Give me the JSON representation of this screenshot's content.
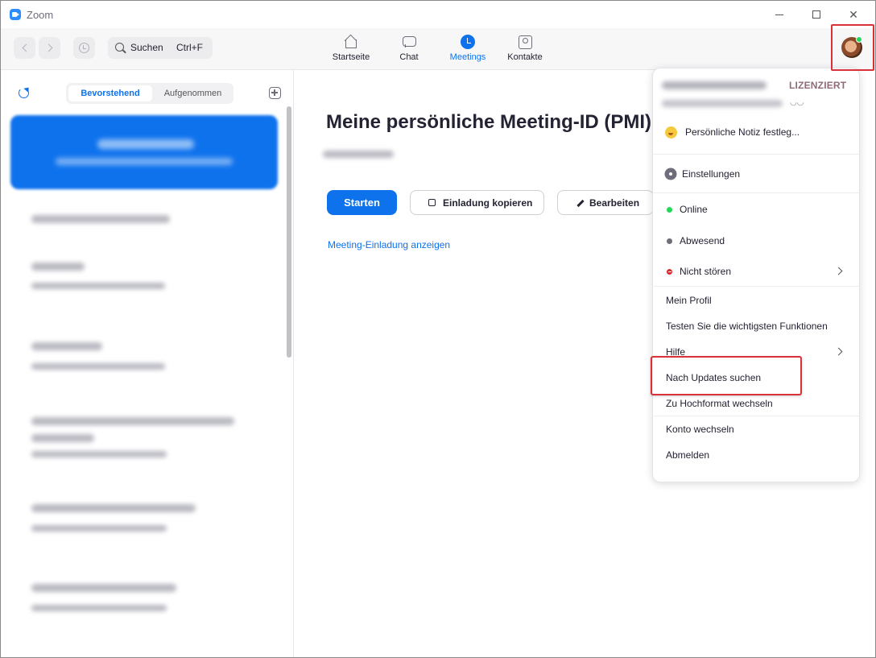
{
  "window": {
    "title": "Zoom",
    "close_glyph": "✕"
  },
  "toolbar": {
    "search_label": "Suchen",
    "search_shortcut": "Ctrl+F",
    "tabs": [
      {
        "label": "Startseite",
        "icon": "home-icon"
      },
      {
        "label": "Chat",
        "icon": "chat-icon"
      },
      {
        "label": "Meetings",
        "icon": "clock-icon",
        "active": true
      },
      {
        "label": "Kontakte",
        "icon": "contacts-icon"
      }
    ]
  },
  "left": {
    "segments": [
      {
        "label": "Bevorstehend",
        "active": true
      },
      {
        "label": "Aufgenommen",
        "active": false
      }
    ]
  },
  "main": {
    "pmi_title": "Meine persönliche Meeting-ID (PMI)",
    "start_label": "Starten",
    "copy_label": "Einladung kopieren",
    "edit_label": "Bearbeiten",
    "invite_link": "Meeting-Einladung anzeigen"
  },
  "menu": {
    "license": "LIZENZIERT",
    "note": "Persönliche Notiz festleg...",
    "settings": "Einstellungen",
    "online": "Online",
    "away": "Abwesend",
    "dnd": "Nicht stören",
    "profile": "Mein Profil",
    "test_features": "Testen Sie die wichtigsten Funktionen",
    "help": "Hilfe",
    "updates": "Nach Updates suchen",
    "portrait": "Zu Hochformat wechseln",
    "switch_account": "Konto wechseln",
    "logout": "Abmelden"
  },
  "colors": {
    "accent": "#0e72ed",
    "highlight": "#d9313a",
    "online": "#23d959",
    "dnd": "#e02828"
  }
}
